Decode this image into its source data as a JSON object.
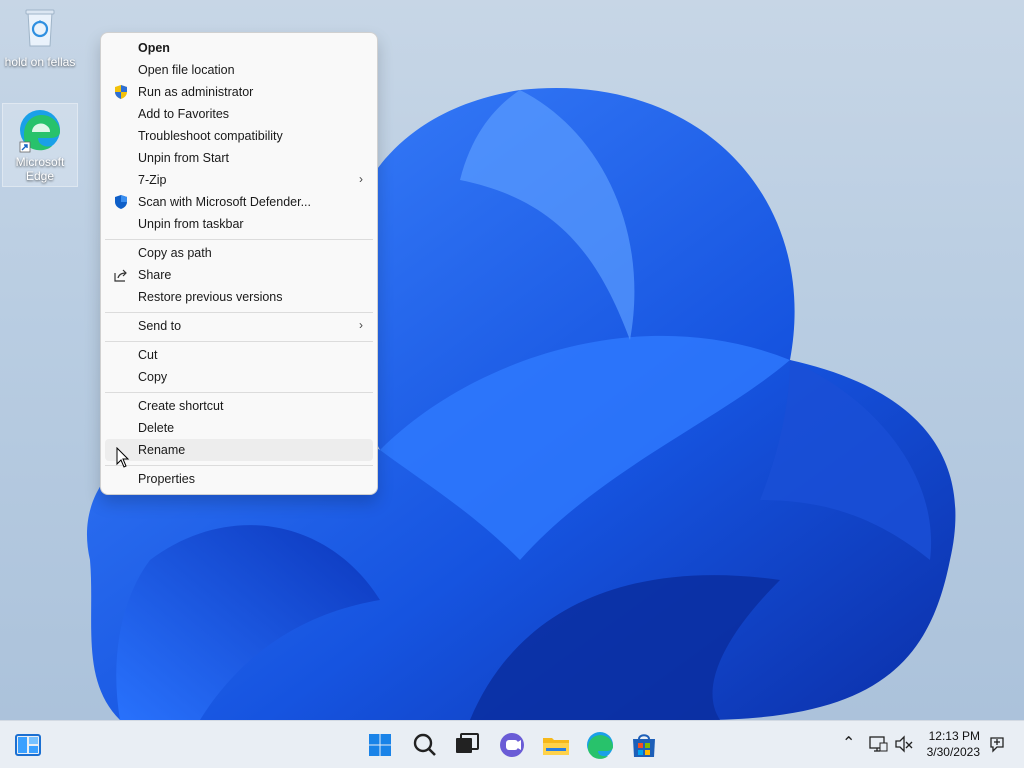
{
  "desktop": {
    "icons": [
      {
        "label": "hold on fellas"
      },
      {
        "label": "Microsoft Edge"
      }
    ]
  },
  "context_menu": {
    "items": [
      {
        "label": "Open"
      },
      {
        "label": "Open file location"
      },
      {
        "label": "Run as administrator"
      },
      {
        "label": "Add to Favorites"
      },
      {
        "label": "Troubleshoot compatibility"
      },
      {
        "label": "Unpin from Start"
      },
      {
        "label": "7-Zip"
      },
      {
        "label": "Scan with Microsoft Defender..."
      },
      {
        "label": "Unpin from taskbar"
      },
      {
        "label": "Copy as path"
      },
      {
        "label": "Share"
      },
      {
        "label": "Restore previous versions"
      },
      {
        "label": "Send to"
      },
      {
        "label": "Cut"
      },
      {
        "label": "Copy"
      },
      {
        "label": "Create shortcut"
      },
      {
        "label": "Delete"
      },
      {
        "label": "Rename"
      },
      {
        "label": "Properties"
      }
    ]
  },
  "taskbar": {
    "clock": {
      "time": "12:13 PM",
      "date": "3/30/2023"
    }
  },
  "colors": {
    "accent": "#0067c0",
    "wallpaper_blue": "#1f5fe0"
  }
}
